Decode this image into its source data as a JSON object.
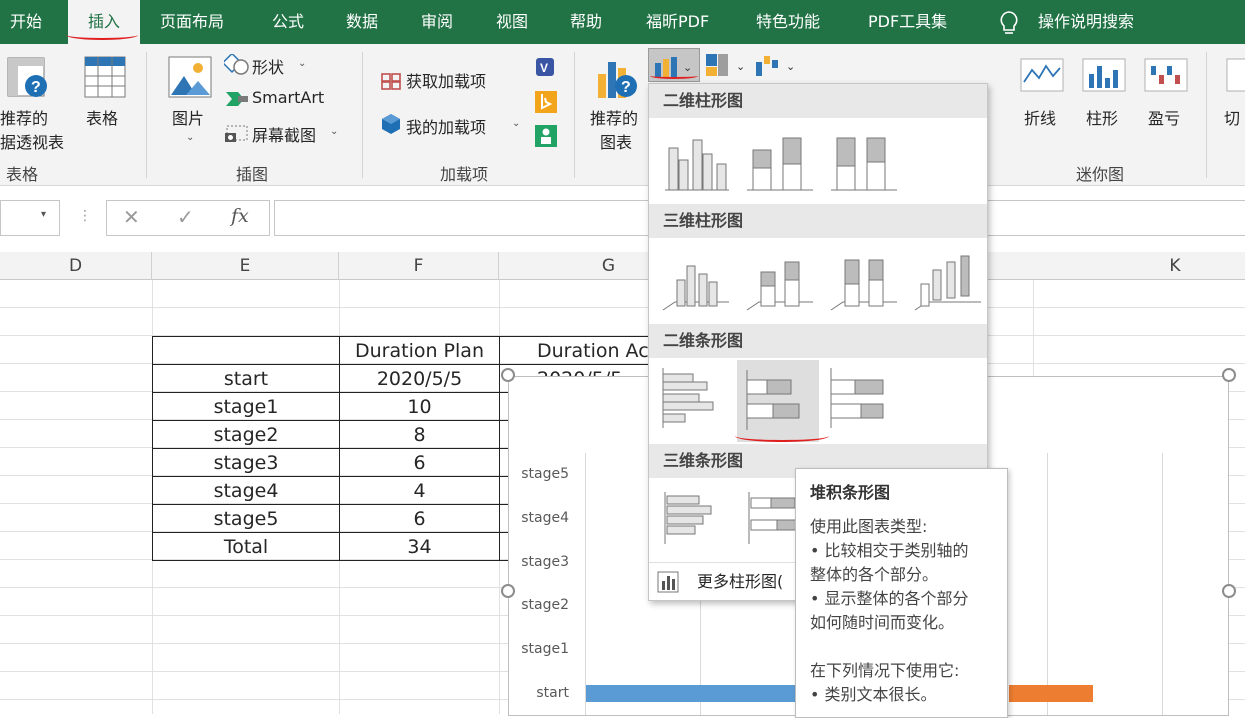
{
  "tabs": [
    "开始",
    "插入",
    "页面布局",
    "公式",
    "数据",
    "审阅",
    "视图",
    "帮助",
    "福昕PDF",
    "特色功能",
    "PDF工具集",
    "操作说明搜索"
  ],
  "active_tab": "插入",
  "ribbon": {
    "tables": {
      "pivot_line1": "推荐的",
      "pivot_line2": "据透视表",
      "table": "表格",
      "group": "表格"
    },
    "illustrations": {
      "picture": "图片",
      "shapes": "形状",
      "smartart": "SmartArt",
      "screenshot": "屏幕截图",
      "group": "插图"
    },
    "addins": {
      "get": "获取加载项",
      "my": "我的加载项",
      "group": "加载项"
    },
    "charts": {
      "recommended_line1": "推荐的",
      "recommended_line2": "图表"
    },
    "sparklines": {
      "line": "折线",
      "column": "柱形",
      "winloss": "盈亏",
      "group": "迷你图"
    },
    "cut": "切"
  },
  "formula_bar": {
    "cancel": "✕",
    "enter": "✓",
    "fx": "fx",
    "value": ""
  },
  "columns": [
    "D",
    "E",
    "F",
    "G",
    "K"
  ],
  "table": {
    "headers": [
      "",
      "Duration Plan",
      "Duration Ac"
    ],
    "rows": [
      {
        "label": "start",
        "plan": "2020/5/5",
        "actual": "2020/5/5"
      },
      {
        "label": "stage1",
        "plan": "10",
        "actual": ""
      },
      {
        "label": "stage2",
        "plan": "8",
        "actual": ""
      },
      {
        "label": "stage3",
        "plan": "6",
        "actual": ""
      },
      {
        "label": "stage4",
        "plan": "4",
        "actual": ""
      },
      {
        "label": "stage5",
        "plan": "6",
        "actual": ""
      },
      {
        "label": "Total",
        "plan": "34",
        "actual": ""
      }
    ]
  },
  "chart_data": {
    "type": "bar",
    "categories": [
      "stage5",
      "stage4",
      "stage3",
      "stage2",
      "stage1",
      "start"
    ],
    "colors": [
      "#5b9bd5",
      "#ed7d31"
    ]
  },
  "dropdown": {
    "sections": [
      "二维柱形图",
      "三维柱形图",
      "二维条形图",
      "三维条形图"
    ],
    "more": "更多柱形图("
  },
  "tooltip": {
    "title": "堆积条形图",
    "lines": [
      "使用此图表类型:",
      "• 比较相交于类别轴的",
      "整体的各个部分。",
      "• 显示整体的各个部分",
      "如何随时间而变化。",
      "",
      "在下列情况下使用它:",
      "• 类别文本很长。"
    ]
  },
  "colors": {
    "excel_green": "#217346",
    "annotation_red": "#e02020"
  }
}
